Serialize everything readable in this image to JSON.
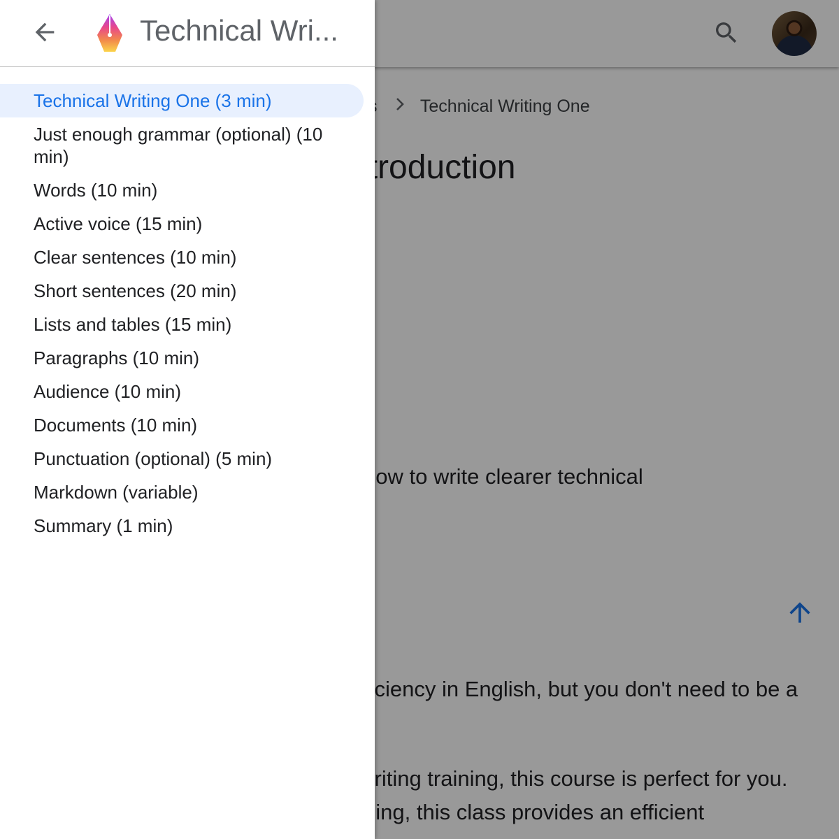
{
  "header": {
    "title": "Technical Wri...",
    "back_icon": "arrow-back-icon",
    "logo_icon": "pen-nib-logo",
    "search_icon": "search-icon",
    "avatar": "user-avatar"
  },
  "background": {
    "breadcrumb_partial": "ts",
    "breadcrumb_current": "Technical Writing One",
    "heading_partial": "ntroduction",
    "para1": "how to write clearer technical",
    "para2": "ficiency in English, but you don't need to be a",
    "para3": "vriting training, this course is perfect for you.",
    "para4": "ning, this class provides an efficient",
    "back_to_top_icon": "arrow-up-icon"
  },
  "nav": {
    "items": [
      {
        "label": "Technical Writing One (3 min)",
        "active": true
      },
      {
        "label": "Just enough grammar (optional) (10 min)"
      },
      {
        "label": "Words (10 min)"
      },
      {
        "label": "Active voice (15 min)"
      },
      {
        "label": "Clear sentences (10 min)"
      },
      {
        "label": "Short sentences (20 min)"
      },
      {
        "label": "Lists and tables (15 min)"
      },
      {
        "label": "Paragraphs (10 min)"
      },
      {
        "label": "Audience (10 min)"
      },
      {
        "label": "Documents (10 min)"
      },
      {
        "label": "Punctuation (optional) (5 min)"
      },
      {
        "label": "Markdown (variable)"
      },
      {
        "label": "Summary (1 min)"
      }
    ]
  },
  "colors": {
    "accent": "#1a73e8",
    "active_bg": "#e8f0fe",
    "scrim": "#9a9a9a"
  }
}
